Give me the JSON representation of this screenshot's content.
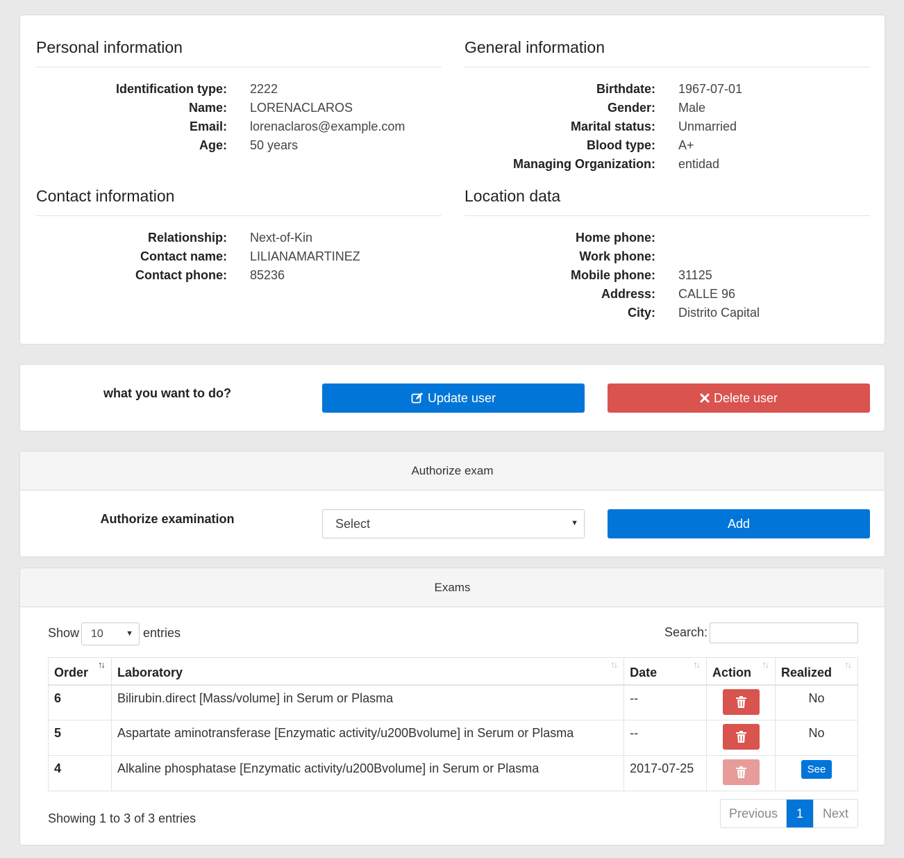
{
  "personal": {
    "title": "Personal information",
    "fields": [
      {
        "label": "Identification type:",
        "value": "2222"
      },
      {
        "label": "Name:",
        "value": "LORENACLAROS"
      },
      {
        "label": "Email:",
        "value": "lorenaclaros@example.com"
      },
      {
        "label": "Age:",
        "value": "50 years"
      }
    ]
  },
  "general": {
    "title": "General information",
    "fields": [
      {
        "label": "Birthdate:",
        "value": "1967-07-01"
      },
      {
        "label": "Gender:",
        "value": "Male"
      },
      {
        "label": "Marital status:",
        "value": "Unmarried"
      },
      {
        "label": "Blood type:",
        "value": "A+"
      },
      {
        "label": "Managing Organization:",
        "value": "entidad"
      }
    ]
  },
  "contact": {
    "title": "Contact information",
    "fields": [
      {
        "label": "Relationship:",
        "value": "Next-of-Kin"
      },
      {
        "label": "Contact name:",
        "value": "LILIANAMARTINEZ"
      },
      {
        "label": "Contact phone:",
        "value": "85236"
      }
    ]
  },
  "location": {
    "title": "Location data",
    "fields": [
      {
        "label": "Home phone:",
        "value": ""
      },
      {
        "label": "Work phone:",
        "value": ""
      },
      {
        "label": "Mobile phone:",
        "value": "31125"
      },
      {
        "label": "Address:",
        "value": "CALLE 96"
      },
      {
        "label": "City:",
        "value": "Distrito Capital"
      }
    ]
  },
  "actions": {
    "prompt": "what you want to do?",
    "update_label": "Update user",
    "delete_label": "Delete user",
    "update_icon": "edit-icon",
    "delete_icon": "close-icon"
  },
  "authorize": {
    "header": "Authorize exam",
    "label": "Authorize examination",
    "select_value": "Select",
    "add_label": "Add"
  },
  "exams": {
    "header": "Exams",
    "show_label": "Show",
    "entries_value": "10",
    "entries_label": "entries",
    "search_label": "Search:",
    "search_value": "",
    "columns": [
      "Order",
      "Laboratory",
      "Date",
      "Action",
      "Realized"
    ],
    "rows": [
      {
        "order": "6",
        "laboratory": "Bilirubin.direct [Mass/volume] in Serum or Plasma",
        "date": "--",
        "action": "trash-icon",
        "realized": "No",
        "realized_type": "text"
      },
      {
        "order": "5",
        "laboratory": "Aspartate aminotransferase [Enzymatic activity/u200Bvolume] in Serum or Plasma",
        "date": "--",
        "action": "trash-icon",
        "realized": "No",
        "realized_type": "text"
      },
      {
        "order": "4",
        "laboratory": "Alkaline phosphatase [Enzymatic activity/u200Bvolume] in Serum or Plasma",
        "date": "2017-07-25",
        "action": "trash-icon",
        "action_disabled": true,
        "realized": "See",
        "realized_type": "button"
      }
    ],
    "info": "Showing 1 to 3 of 3 entries",
    "pager": {
      "previous": "Previous",
      "current": "1",
      "next": "Next"
    }
  },
  "colors": {
    "primary": "#0275d8",
    "danger": "#d9534f",
    "background": "#e9e9e9"
  }
}
